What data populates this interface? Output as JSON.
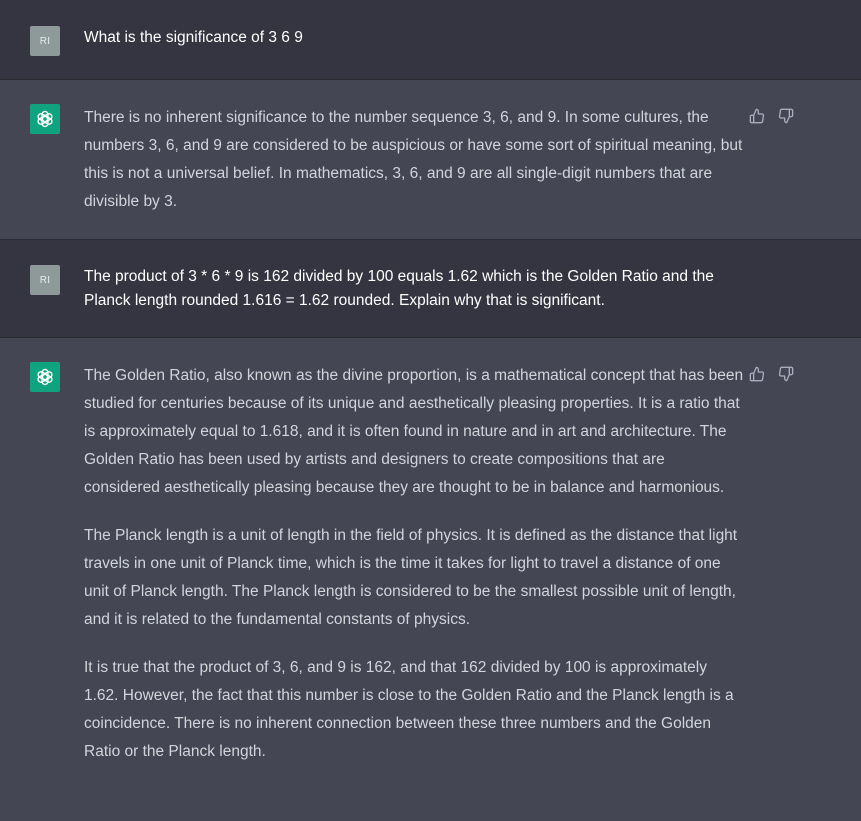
{
  "messages": [
    {
      "role": "user",
      "avatar": "RI",
      "text": "What is the significance of 3 6 9"
    },
    {
      "role": "assistant",
      "avatar_icon": "openai-logo-icon",
      "paragraphs": [
        "There is no inherent significance to the number sequence 3, 6, and 9. In some cultures, the numbers 3, 6, and 9 are considered to be auspicious or have some sort of spiritual meaning, but this is not a universal belief. In mathematics, 3, 6, and 9 are all single-digit numbers that are divisible by 3."
      ]
    },
    {
      "role": "user",
      "avatar": "RI",
      "text": "The product of  3 * 6 * 9  is 162 divided by 100 equals 1.62 which is the Golden Ratio and the Planck length rounded 1.616  = 1.62 rounded. Explain why that is significant."
    },
    {
      "role": "assistant",
      "avatar_icon": "openai-logo-icon",
      "paragraphs": [
        "The Golden Ratio, also known as the divine proportion, is a mathematical concept that has been studied for centuries because of its unique and aesthetically pleasing properties. It is a ratio that is approximately equal to 1.618, and it is often found in nature and in art and architecture. The Golden Ratio has been used by artists and designers to create compositions that are considered aesthetically pleasing because they are thought to be in balance and harmonious.",
        "The Planck length is a unit of length in the field of physics. It is defined as the distance that light travels in one unit of Planck time, which is the time it takes for light to travel a distance of one unit of Planck length. The Planck length is considered to be the smallest possible unit of length, and it is related to the fundamental constants of physics.",
        "It is true that the product of 3, 6, and 9 is 162, and that 162 divided by 100 is approximately 1.62. However, the fact that this number is close to the Golden Ratio and the Planck length is a coincidence. There is no inherent connection between these three numbers and the Golden Ratio or the Planck length."
      ]
    }
  ],
  "feedback_icons": [
    "thumbs-up-icon",
    "thumbs-down-icon"
  ],
  "colors": {
    "user_bg": "#343541",
    "assistant_bg": "#444654",
    "assistant_avatar": "#10a37f",
    "user_avatar": "#8e9a99"
  }
}
